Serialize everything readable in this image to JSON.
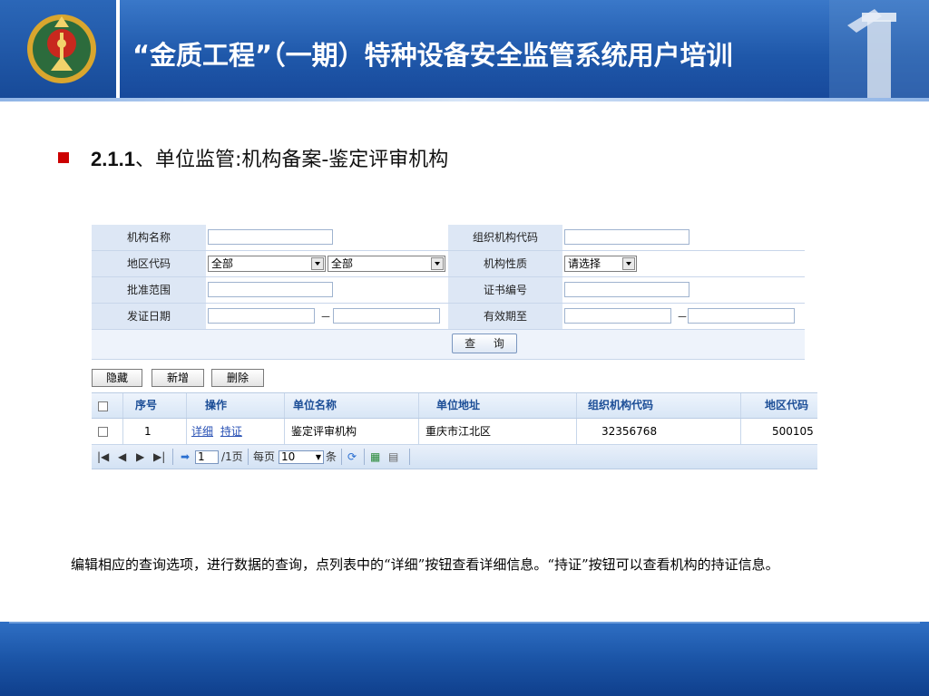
{
  "header": {
    "title": "“金质工程”（一期）特种设备安全监管系统用户培训"
  },
  "section": {
    "number": "2.1.1",
    "title": "、单位监管:机构备案-鉴定评审机构"
  },
  "form": {
    "org_name_label": "机构名称",
    "org_code_label": "组织机构代码",
    "region_label": "地区代码",
    "region_select1": "全部",
    "region_select2": "全部",
    "nature_label": "机构性质",
    "nature_select": "请选择",
    "scope_label": "批准范围",
    "cert_no_label": "证书编号",
    "issue_date_label": "发证日期",
    "valid_until_label": "有效期至",
    "date_separator": "－",
    "query_button": "查 询"
  },
  "toolbar": {
    "hide_label": "隐藏",
    "add_label": "新增",
    "delete_label": "删除"
  },
  "grid": {
    "columns": [
      "序号",
      "操作",
      "单位名称",
      "单位地址",
      "组织机构代码",
      "地区代码"
    ],
    "rows": [
      {
        "index": "1",
        "action_detail": "详细",
        "action_cert": "持证",
        "name": "鉴定评审机构",
        "address": "重庆市江北区",
        "org_code": "32356768",
        "region_code": "500105"
      }
    ]
  },
  "pager": {
    "page_input": "1",
    "total_pages": "/1页",
    "per_page_label": "每页",
    "per_page_value": "10",
    "per_page_unit": "条"
  },
  "description": "编辑相应的查询选项，进行数据的查询，点列表中的“详细”按钮查看详细信息。“持证”按钮可以查看机构的持证信息。",
  "colors": {
    "header_blue": "#1f58aa",
    "bullet_red": "#cc0000",
    "link_blue": "#2a52b5",
    "grid_header_text": "#1c4e97"
  }
}
